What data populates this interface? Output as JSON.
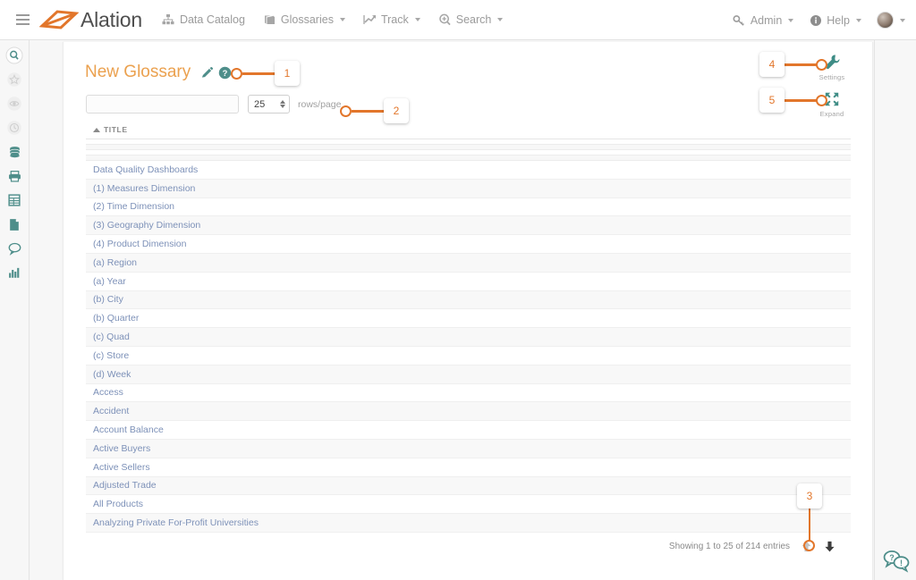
{
  "navbar": {
    "menu_icon": "hamburger-icon",
    "brand": "Alation",
    "items": [
      {
        "label": "Data Catalog",
        "icon": "sitemap-icon",
        "caret": false
      },
      {
        "label": "Glossaries",
        "icon": "book-icon",
        "caret": true
      },
      {
        "label": "Track",
        "icon": "trend-line-icon",
        "caret": true
      },
      {
        "label": "Search",
        "icon": "search-plus-icon",
        "caret": true
      }
    ],
    "right_items": [
      {
        "label": "Admin",
        "icon": "key-icon",
        "caret": true
      },
      {
        "label": "Help",
        "icon": "info-circle-icon",
        "caret": true
      }
    ],
    "avatar": "user-avatar"
  },
  "left_rail": {
    "items": [
      {
        "icon": "search-circle-icon",
        "active": true
      },
      {
        "icon": "star-circle-icon",
        "active": false
      },
      {
        "icon": "eye-circle-icon",
        "active": false
      },
      {
        "icon": "clock-circle-icon",
        "active": false
      },
      {
        "icon": "database-icon",
        "active": false
      },
      {
        "icon": "folder-icon",
        "active": false
      },
      {
        "icon": "table-icon",
        "active": false
      },
      {
        "icon": "document-icon",
        "active": false
      },
      {
        "icon": "comment-icon",
        "active": false
      },
      {
        "icon": "bar-chart-icon",
        "active": false
      }
    ]
  },
  "right_rail": {
    "chat_icon": "chat-bubbles-icon"
  },
  "page": {
    "title": "New Glossary",
    "edit_icon": "pencil-icon",
    "help_icon": "question-circle-icon",
    "accent_color": "#eba14f",
    "annotation_color": "#e2762b"
  },
  "controls": {
    "search_value": "",
    "search_placeholder": "",
    "rows_per_page_value": "25",
    "rows_per_page_label": "rows/page"
  },
  "table": {
    "column_header": "TITLE",
    "sort_direction": "asc",
    "filler_rows": 4,
    "rows": [
      {
        "title": "Data Quality Dashboards"
      },
      {
        "title": "(1) Measures Dimension"
      },
      {
        "title": "(2) Time Dimension"
      },
      {
        "title": "(3) Geography Dimension"
      },
      {
        "title": "(4) Product Dimension"
      },
      {
        "title": "(a) Region"
      },
      {
        "title": "(a) Year"
      },
      {
        "title": "(b) City"
      },
      {
        "title": "(b) Quarter"
      },
      {
        "title": "(c) Quad"
      },
      {
        "title": "(c) Store"
      },
      {
        "title": "(d) Week"
      },
      {
        "title": "Access"
      },
      {
        "title": "Accident"
      },
      {
        "title": "Account Balance"
      },
      {
        "title": "Active Buyers"
      },
      {
        "title": "Active Sellers"
      },
      {
        "title": "Adjusted Trade"
      },
      {
        "title": "All Products"
      },
      {
        "title": "Analyzing Private For-Profit Universities"
      }
    ],
    "footer_text": "Showing 1 to 25 of 214 entries",
    "prev_icon": "arrow-up-icon",
    "next_icon": "arrow-down-icon"
  },
  "tools": [
    {
      "label": "Settings",
      "icon": "wrench-icon"
    },
    {
      "label": "Expand",
      "icon": "expand-icon"
    }
  ],
  "annotations": [
    {
      "number": "1"
    },
    {
      "number": "2"
    },
    {
      "number": "3"
    },
    {
      "number": "4"
    },
    {
      "number": "5"
    }
  ]
}
